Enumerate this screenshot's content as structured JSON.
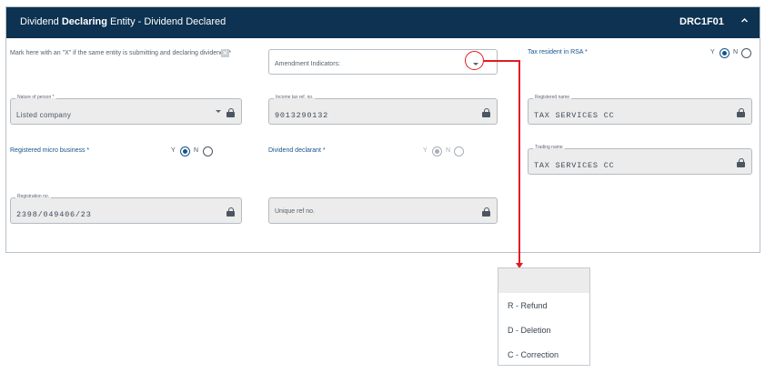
{
  "header": {
    "title_pre": "Dividend ",
    "title_bold": "Declaring",
    "title_post": " Entity - Dividend Declared",
    "code": "DRC1F01",
    "collapse_icon": "chevron-up-icon"
  },
  "row1": {
    "same_entity_label": "Mark here with an \"X\" if the same entity is submitting and declaring dividends",
    "same_entity_required": "*",
    "same_entity_mark": "✕",
    "amendment_placeholder": "Amendment Indicators:",
    "tax_resident_label": "Tax resident in RSA *",
    "tax_resident_yes": "Y",
    "tax_resident_no": "N",
    "tax_resident_value": "Y"
  },
  "row2": {
    "nature_label": "Nature of person *",
    "nature_value": "Listed company",
    "income_tax_label": "Income tax ref. no.",
    "income_tax_value": "9013290132",
    "registered_name_label": "Registered name",
    "registered_name_value": "TAX SERVICES CC"
  },
  "row3": {
    "micro_label": "Registered micro business *",
    "micro_yes": "Y",
    "micro_no": "N",
    "micro_value": "Y",
    "declarant_label": "Dividend declarant *",
    "declarant_yes": "Y",
    "declarant_no": "N",
    "declarant_value": "Y",
    "trading_name_label": "Trading name",
    "trading_name_value": "TAX SERVICES CC"
  },
  "row4": {
    "registration_label": "Registration no.",
    "registration_value": "2398/049406/23",
    "unique_ref_placeholder": "Unique ref no."
  },
  "amendment_options": [
    "R - Refund",
    "D - Deletion",
    "C - Correction"
  ],
  "colors": {
    "header_bg": "#0e3251",
    "accent": "#16548c",
    "annotation": "#e21b23"
  }
}
